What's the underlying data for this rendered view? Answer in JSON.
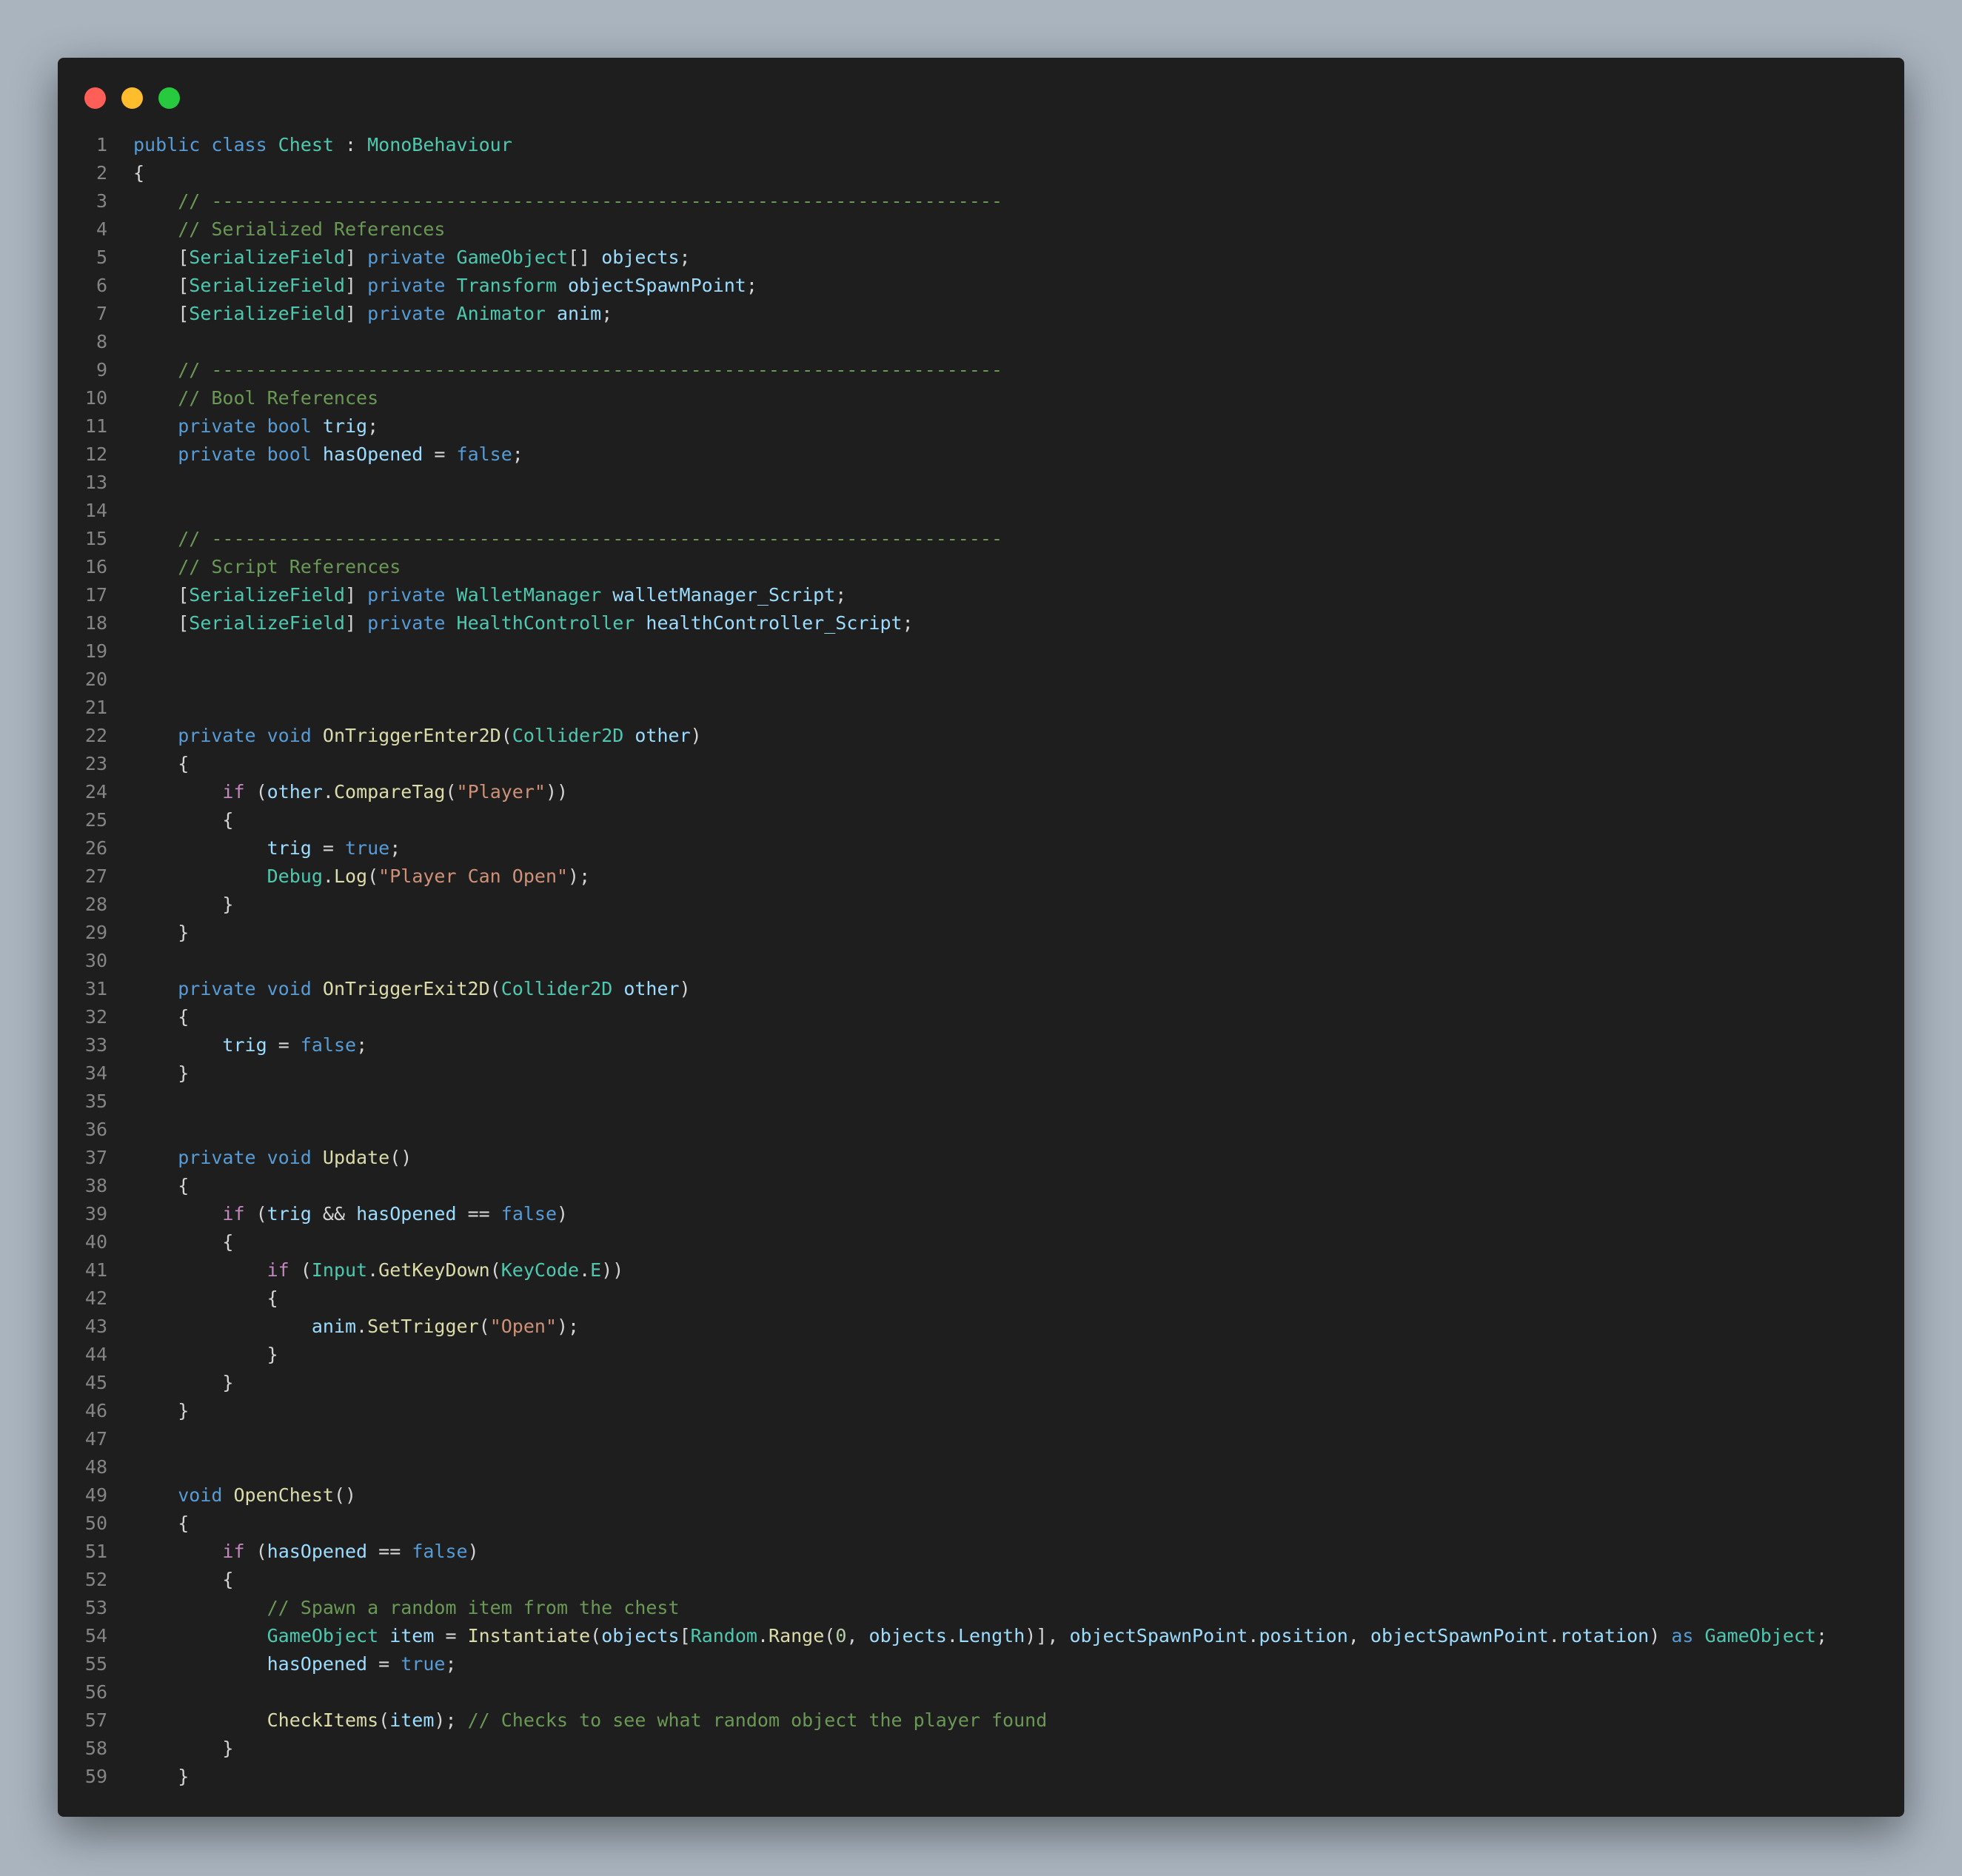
{
  "window": {
    "controls": [
      {
        "name": "close",
        "color": "#ff5f56"
      },
      {
        "name": "minimize",
        "color": "#ffbd2e"
      },
      {
        "name": "maximize",
        "color": "#27c93f"
      }
    ]
  },
  "colors": {
    "background": "#a9b4bf",
    "editor": "#1e1e1e",
    "kw": "#569cd6",
    "ct": "#c586c0",
    "ty": "#4ec9b0",
    "fn": "#dcdcaa",
    "vr": "#9cdcfe",
    "st": "#ce9178",
    "nm": "#b5cea8",
    "cm": "#6a9955",
    "pn": "#d4d4d4"
  },
  "code": {
    "lines": [
      {
        "n": "1",
        "t": [
          [
            "kw",
            "public class "
          ],
          [
            "ty",
            "Chest"
          ],
          [
            "pn",
            " : "
          ],
          [
            "ty",
            "MonoBehaviour"
          ]
        ]
      },
      {
        "n": "2",
        "t": [
          [
            "pn",
            "{"
          ]
        ]
      },
      {
        "n": "3",
        "t": [
          [
            "pn",
            "    "
          ],
          [
            "cm",
            "// -----------------------------------------------------------------------"
          ]
        ]
      },
      {
        "n": "4",
        "t": [
          [
            "pn",
            "    "
          ],
          [
            "cm",
            "// Serialized References"
          ]
        ]
      },
      {
        "n": "5",
        "t": [
          [
            "pn",
            "    ["
          ],
          [
            "ty",
            "SerializeField"
          ],
          [
            "pn",
            "] "
          ],
          [
            "kw",
            "private "
          ],
          [
            "ty",
            "GameObject"
          ],
          [
            "pn",
            "[] "
          ],
          [
            "vr",
            "objects"
          ],
          [
            "pn",
            ";"
          ]
        ]
      },
      {
        "n": "6",
        "t": [
          [
            "pn",
            "    ["
          ],
          [
            "ty",
            "SerializeField"
          ],
          [
            "pn",
            "] "
          ],
          [
            "kw",
            "private "
          ],
          [
            "ty",
            "Transform "
          ],
          [
            "vr",
            "objectSpawnPoint"
          ],
          [
            "pn",
            ";"
          ]
        ]
      },
      {
        "n": "7",
        "t": [
          [
            "pn",
            "    ["
          ],
          [
            "ty",
            "SerializeField"
          ],
          [
            "pn",
            "] "
          ],
          [
            "kw",
            "private "
          ],
          [
            "ty",
            "Animator "
          ],
          [
            "vr",
            "anim"
          ],
          [
            "pn",
            ";"
          ]
        ]
      },
      {
        "n": "8",
        "t": []
      },
      {
        "n": "9",
        "t": [
          [
            "pn",
            "    "
          ],
          [
            "cm",
            "// -----------------------------------------------------------------------"
          ]
        ]
      },
      {
        "n": "10",
        "t": [
          [
            "pn",
            "    "
          ],
          [
            "cm",
            "// Bool References"
          ]
        ]
      },
      {
        "n": "11",
        "t": [
          [
            "pn",
            "    "
          ],
          [
            "kw",
            "private bool "
          ],
          [
            "vr",
            "trig"
          ],
          [
            "pn",
            ";"
          ]
        ]
      },
      {
        "n": "12",
        "t": [
          [
            "pn",
            "    "
          ],
          [
            "kw",
            "private bool "
          ],
          [
            "vr",
            "hasOpened"
          ],
          [
            "pn",
            " = "
          ],
          [
            "kw",
            "false"
          ],
          [
            "pn",
            ";"
          ]
        ]
      },
      {
        "n": "13",
        "t": []
      },
      {
        "n": "14",
        "t": []
      },
      {
        "n": "15",
        "t": [
          [
            "pn",
            "    "
          ],
          [
            "cm",
            "// -----------------------------------------------------------------------"
          ]
        ]
      },
      {
        "n": "16",
        "t": [
          [
            "pn",
            "    "
          ],
          [
            "cm",
            "// Script References"
          ]
        ]
      },
      {
        "n": "17",
        "t": [
          [
            "pn",
            "    ["
          ],
          [
            "ty",
            "SerializeField"
          ],
          [
            "pn",
            "] "
          ],
          [
            "kw",
            "private "
          ],
          [
            "ty",
            "WalletManager "
          ],
          [
            "vr",
            "walletManager_Script"
          ],
          [
            "pn",
            ";"
          ]
        ]
      },
      {
        "n": "18",
        "t": [
          [
            "pn",
            "    ["
          ],
          [
            "ty",
            "SerializeField"
          ],
          [
            "pn",
            "] "
          ],
          [
            "kw",
            "private "
          ],
          [
            "ty",
            "HealthController "
          ],
          [
            "vr",
            "healthController_Script"
          ],
          [
            "pn",
            ";"
          ]
        ]
      },
      {
        "n": "19",
        "t": []
      },
      {
        "n": "20",
        "t": []
      },
      {
        "n": "21",
        "t": []
      },
      {
        "n": "22",
        "t": [
          [
            "pn",
            "    "
          ],
          [
            "kw",
            "private void "
          ],
          [
            "fn",
            "OnTriggerEnter2D"
          ],
          [
            "pn",
            "("
          ],
          [
            "ty",
            "Collider2D "
          ],
          [
            "vr",
            "other"
          ],
          [
            "pn",
            ")"
          ]
        ]
      },
      {
        "n": "23",
        "t": [
          [
            "pn",
            "    {"
          ]
        ]
      },
      {
        "n": "24",
        "t": [
          [
            "pn",
            "        "
          ],
          [
            "ct",
            "if"
          ],
          [
            "pn",
            " ("
          ],
          [
            "vr",
            "other"
          ],
          [
            "pn",
            "."
          ],
          [
            "fn",
            "CompareTag"
          ],
          [
            "pn",
            "("
          ],
          [
            "st",
            "\"Player\""
          ],
          [
            "pn",
            "))"
          ]
        ]
      },
      {
        "n": "25",
        "t": [
          [
            "pn",
            "        {"
          ]
        ]
      },
      {
        "n": "26",
        "t": [
          [
            "pn",
            "            "
          ],
          [
            "vr",
            "trig"
          ],
          [
            "pn",
            " = "
          ],
          [
            "kw",
            "true"
          ],
          [
            "pn",
            ";"
          ]
        ]
      },
      {
        "n": "27",
        "t": [
          [
            "pn",
            "            "
          ],
          [
            "ty",
            "Debug"
          ],
          [
            "pn",
            "."
          ],
          [
            "fn",
            "Log"
          ],
          [
            "pn",
            "("
          ],
          [
            "st",
            "\"Player Can Open\""
          ],
          [
            "pn",
            ");"
          ]
        ]
      },
      {
        "n": "28",
        "t": [
          [
            "pn",
            "        }"
          ]
        ]
      },
      {
        "n": "29",
        "t": [
          [
            "pn",
            "    }"
          ]
        ]
      },
      {
        "n": "30",
        "t": []
      },
      {
        "n": "31",
        "t": [
          [
            "pn",
            "    "
          ],
          [
            "kw",
            "private void "
          ],
          [
            "fn",
            "OnTriggerExit2D"
          ],
          [
            "pn",
            "("
          ],
          [
            "ty",
            "Collider2D "
          ],
          [
            "vr",
            "other"
          ],
          [
            "pn",
            ")"
          ]
        ]
      },
      {
        "n": "32",
        "t": [
          [
            "pn",
            "    {"
          ]
        ]
      },
      {
        "n": "33",
        "t": [
          [
            "pn",
            "        "
          ],
          [
            "vr",
            "trig"
          ],
          [
            "pn",
            " = "
          ],
          [
            "kw",
            "false"
          ],
          [
            "pn",
            ";"
          ]
        ]
      },
      {
        "n": "34",
        "t": [
          [
            "pn",
            "    }"
          ]
        ]
      },
      {
        "n": "35",
        "t": []
      },
      {
        "n": "36",
        "t": []
      },
      {
        "n": "37",
        "t": [
          [
            "pn",
            "    "
          ],
          [
            "kw",
            "private void "
          ],
          [
            "fn",
            "Update"
          ],
          [
            "pn",
            "()"
          ]
        ]
      },
      {
        "n": "38",
        "t": [
          [
            "pn",
            "    {"
          ]
        ]
      },
      {
        "n": "39",
        "t": [
          [
            "pn",
            "        "
          ],
          [
            "ct",
            "if"
          ],
          [
            "pn",
            " ("
          ],
          [
            "vr",
            "trig"
          ],
          [
            "pn",
            " && "
          ],
          [
            "vr",
            "hasOpened"
          ],
          [
            "pn",
            " == "
          ],
          [
            "kw",
            "false"
          ],
          [
            "pn",
            ")"
          ]
        ]
      },
      {
        "n": "40",
        "t": [
          [
            "pn",
            "        {"
          ]
        ]
      },
      {
        "n": "41",
        "t": [
          [
            "pn",
            "            "
          ],
          [
            "ct",
            "if"
          ],
          [
            "pn",
            " ("
          ],
          [
            "ty",
            "Input"
          ],
          [
            "pn",
            "."
          ],
          [
            "fn",
            "GetKeyDown"
          ],
          [
            "pn",
            "("
          ],
          [
            "ty",
            "KeyCode"
          ],
          [
            "pn",
            "."
          ],
          [
            "ty",
            "E"
          ],
          [
            "pn",
            "))"
          ]
        ]
      },
      {
        "n": "42",
        "t": [
          [
            "pn",
            "            {"
          ]
        ]
      },
      {
        "n": "43",
        "t": [
          [
            "pn",
            "                "
          ],
          [
            "vr",
            "anim"
          ],
          [
            "pn",
            "."
          ],
          [
            "fn",
            "SetTrigger"
          ],
          [
            "pn",
            "("
          ],
          [
            "st",
            "\"Open\""
          ],
          [
            "pn",
            ");"
          ]
        ]
      },
      {
        "n": "44",
        "t": [
          [
            "pn",
            "            }"
          ]
        ]
      },
      {
        "n": "45",
        "t": [
          [
            "pn",
            "        }"
          ]
        ]
      },
      {
        "n": "46",
        "t": [
          [
            "pn",
            "    }"
          ]
        ]
      },
      {
        "n": "47",
        "t": []
      },
      {
        "n": "48",
        "t": []
      },
      {
        "n": "49",
        "t": [
          [
            "pn",
            "    "
          ],
          [
            "kw",
            "void "
          ],
          [
            "fn",
            "OpenChest"
          ],
          [
            "pn",
            "()"
          ]
        ]
      },
      {
        "n": "50",
        "t": [
          [
            "pn",
            "    {"
          ]
        ]
      },
      {
        "n": "51",
        "t": [
          [
            "pn",
            "        "
          ],
          [
            "ct",
            "if"
          ],
          [
            "pn",
            " ("
          ],
          [
            "vr",
            "hasOpened"
          ],
          [
            "pn",
            " == "
          ],
          [
            "kw",
            "false"
          ],
          [
            "pn",
            ")"
          ]
        ]
      },
      {
        "n": "52",
        "t": [
          [
            "pn",
            "        {"
          ]
        ]
      },
      {
        "n": "53",
        "t": [
          [
            "pn",
            "            "
          ],
          [
            "cm",
            "// Spawn a random item from the chest"
          ]
        ]
      },
      {
        "n": "54",
        "t": [
          [
            "pn",
            "            "
          ],
          [
            "ty",
            "GameObject "
          ],
          [
            "vr",
            "item"
          ],
          [
            "pn",
            " = "
          ],
          [
            "fn",
            "Instantiate"
          ],
          [
            "pn",
            "("
          ],
          [
            "vr",
            "objects"
          ],
          [
            "pn",
            "["
          ],
          [
            "ty",
            "Random"
          ],
          [
            "pn",
            "."
          ],
          [
            "fn",
            "Range"
          ],
          [
            "pn",
            "("
          ],
          [
            "nm",
            "0"
          ],
          [
            "pn",
            ", "
          ],
          [
            "vr",
            "objects"
          ],
          [
            "pn",
            "."
          ],
          [
            "vr",
            "Length"
          ],
          [
            "pn",
            ")], "
          ],
          [
            "vr",
            "objectSpawnPoint"
          ],
          [
            "pn",
            "."
          ],
          [
            "vr",
            "position"
          ],
          [
            "pn",
            ", "
          ],
          [
            "vr",
            "objectSpawnPoint"
          ],
          [
            "pn",
            "."
          ],
          [
            "vr",
            "rotation"
          ],
          [
            "pn",
            ") "
          ],
          [
            "kw",
            "as "
          ],
          [
            "ty",
            "GameObject"
          ],
          [
            "pn",
            ";"
          ]
        ]
      },
      {
        "n": "55",
        "t": [
          [
            "pn",
            "            "
          ],
          [
            "vr",
            "hasOpened"
          ],
          [
            "pn",
            " = "
          ],
          [
            "kw",
            "true"
          ],
          [
            "pn",
            ";"
          ]
        ]
      },
      {
        "n": "56",
        "t": []
      },
      {
        "n": "57",
        "t": [
          [
            "pn",
            "            "
          ],
          [
            "fn",
            "CheckItems"
          ],
          [
            "pn",
            "("
          ],
          [
            "vr",
            "item"
          ],
          [
            "pn",
            "); "
          ],
          [
            "cm",
            "// Checks to see what random object the player found"
          ]
        ]
      },
      {
        "n": "58",
        "t": [
          [
            "pn",
            "        }"
          ]
        ]
      },
      {
        "n": "59",
        "t": [
          [
            "pn",
            "    }"
          ]
        ]
      }
    ]
  }
}
